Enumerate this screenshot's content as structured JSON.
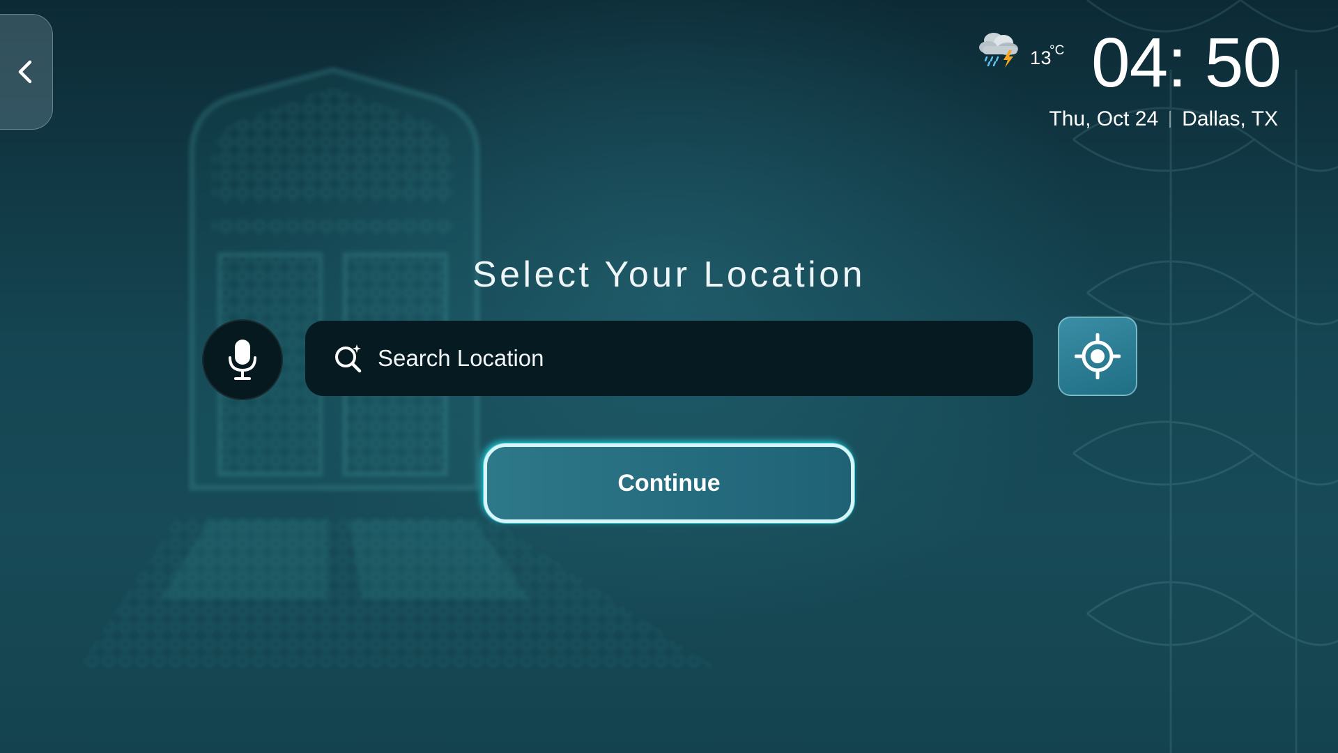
{
  "header": {
    "back_icon": "chevron-left-icon",
    "weather_icon": "thunderstorm-rain-icon",
    "temperature": "13",
    "temperature_unit": "°C",
    "time": "04: 50",
    "date": "Thu, Oct 24",
    "location": "Dallas, TX"
  },
  "main": {
    "title": "Select Your Location",
    "mic_icon": "microphone-icon",
    "search_icon": "search-icon",
    "search_placeholder": "Search Location",
    "search_value": "",
    "locate_icon": "gps-crosshair-icon",
    "continue_label": "Continue"
  },
  "colors": {
    "background": "#154552",
    "search_bar": "#061b21",
    "accent": "#2d7889",
    "glow": "#3cdce6"
  }
}
